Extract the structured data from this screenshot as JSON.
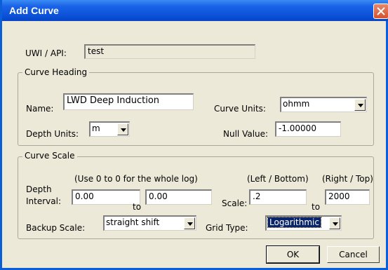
{
  "window": {
    "title": "Add Curve"
  },
  "uwi": {
    "label": "UWI / API:",
    "value": "test"
  },
  "curve_heading": {
    "title": "Curve Heading",
    "name_label": "Name:",
    "name_value": "LWD Deep Induction",
    "curve_units_label": "Curve Units:",
    "curve_units_value": "ohmm",
    "depth_units_label": "Depth Units:",
    "depth_units_value": "m",
    "null_value_label": "Null Value:",
    "null_value": "-1.00000"
  },
  "curve_scale": {
    "title": "Curve Scale",
    "hint": "(Use 0 to 0 for the whole log)",
    "left_bottom_hint": "(Left / Bottom)",
    "right_top_hint": "(Right / Top)",
    "depth_label_line1": "Depth",
    "depth_label_line2": "Interval:",
    "depth_from": "0.00",
    "depth_to_label": "to",
    "depth_to": "0.00",
    "scale_label": "Scale:",
    "scale_left": ".2",
    "scale_to_label": "to",
    "scale_right": "2000",
    "backup_label": "Backup Scale:",
    "backup_value": "straight shift",
    "grid_type_label": "Grid Type:",
    "grid_type_value": "Logarithmic"
  },
  "buttons": {
    "ok": "OK",
    "cancel": "Cancel"
  }
}
